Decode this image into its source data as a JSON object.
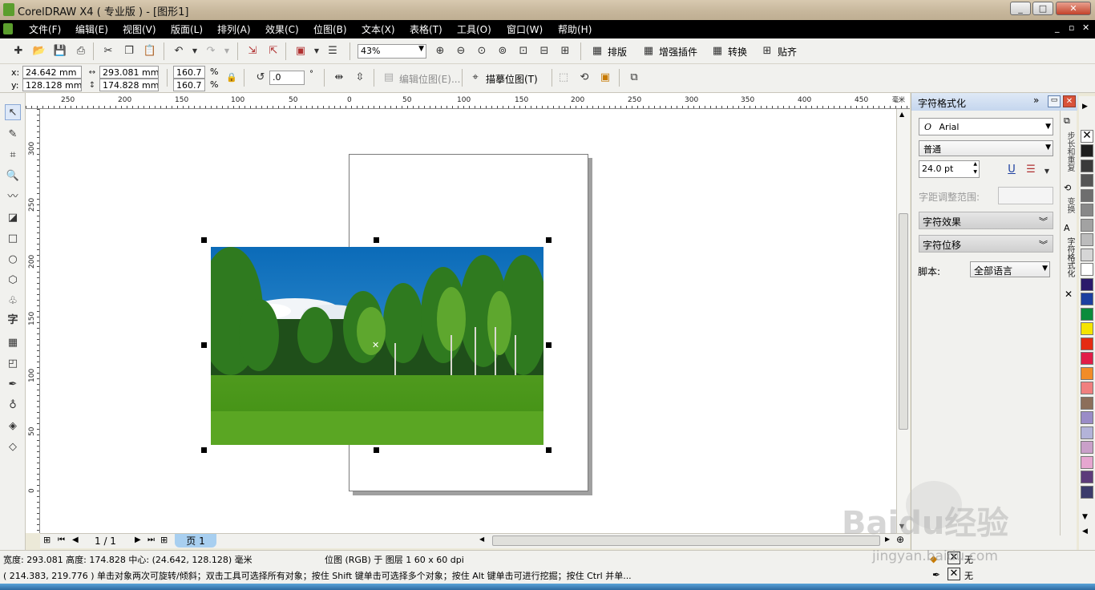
{
  "window": {
    "title": "CorelDRAW X4 ( 专业版 ) - [图形1]",
    "buttons": [
      "_",
      "□",
      "✕"
    ]
  },
  "menu": {
    "items": [
      "文件(F)",
      "编辑(E)",
      "视图(V)",
      "版面(L)",
      "排列(A)",
      "效果(C)",
      "位图(B)",
      "文本(X)",
      "表格(T)",
      "工具(O)",
      "窗口(W)",
      "帮助(H)"
    ],
    "mdi_buttons": [
      "_",
      "▫",
      "✕"
    ]
  },
  "toolbar1": {
    "zoom_value": "43%",
    "buttons": [
      "排版",
      "增强插件",
      "转换",
      "贴齐"
    ]
  },
  "toolbar2": {
    "x_label": "x:",
    "x_value": "24.642 mm",
    "y_label": "y:",
    "y_value": "128.128 mm",
    "w_value": "293.081 mm",
    "h_value": "174.828 mm",
    "scale_x": "160.7",
    "scale_y": "160.7",
    "pct1": "%",
    "pct2": "%",
    "rotation_value": ".0",
    "degree": "°",
    "edit_bitmap": "编辑位图(E)...",
    "trace_bitmap": "描摹位图(T)"
  },
  "ruler": {
    "h_ticks": [
      "250",
      "200",
      "150",
      "100",
      "50",
      "0",
      "50",
      "100",
      "150",
      "200",
      "250",
      "300",
      "350",
      "400",
      "450"
    ],
    "h_unit": "毫米",
    "v_ticks": [
      "300",
      "250",
      "200",
      "150",
      "100",
      "50",
      "0"
    ]
  },
  "navigation": {
    "page_count": "1 / 1",
    "page_tab": "页 1"
  },
  "docker": {
    "title": "字符格式化",
    "font_name": "Arial",
    "font_style": "普通",
    "font_size": "24.0 pt",
    "kerning_label": "字距调整范围:",
    "effects_label": "字符效果",
    "offset_label": "字符位移",
    "script_label": "脚本:",
    "script_value": "全部语言"
  },
  "side_tabs": [
    "步长和重复",
    "变换",
    "字符格式化"
  ],
  "palette": {
    "colors": [
      "#1e1e1e",
      "#3a3a3a",
      "#555555",
      "#6e6e6e",
      "#888888",
      "#a2a2a2",
      "#bcbcbc",
      "#d6d6d6",
      "#ffffff",
      "#2b1a6b",
      "#1c3fa0",
      "#0a8c3c",
      "#f5e400",
      "#e52b12",
      "#e11d48",
      "#f28c28",
      "#f07f7f",
      "#8c6e5a",
      "#9a8cc7",
      "#b3b3d9",
      "#c9a0c9",
      "#e6a6d0",
      "#5c3b7a",
      "#3b3b6b"
    ]
  },
  "status": {
    "line1_left": "宽度: 293.081  高度: 174.828  中心: (24.642, 128.128)  毫米",
    "line1_mid": "位图 (RGB) 于 图层 1 60 x 60 dpi",
    "line2": "( 214.383, 219.776 )   单击对象两次可旋转/倾斜；双击工具可选择所有对象；按住 Shift 键单击可选择多个对象；按住 Alt 键单击可进行挖掘；按住 Ctrl 并单...",
    "fill_none": "无",
    "outline_none": "无"
  },
  "watermark": {
    "brand": "Baidu经验",
    "url": "jingyan.baidu.com"
  }
}
